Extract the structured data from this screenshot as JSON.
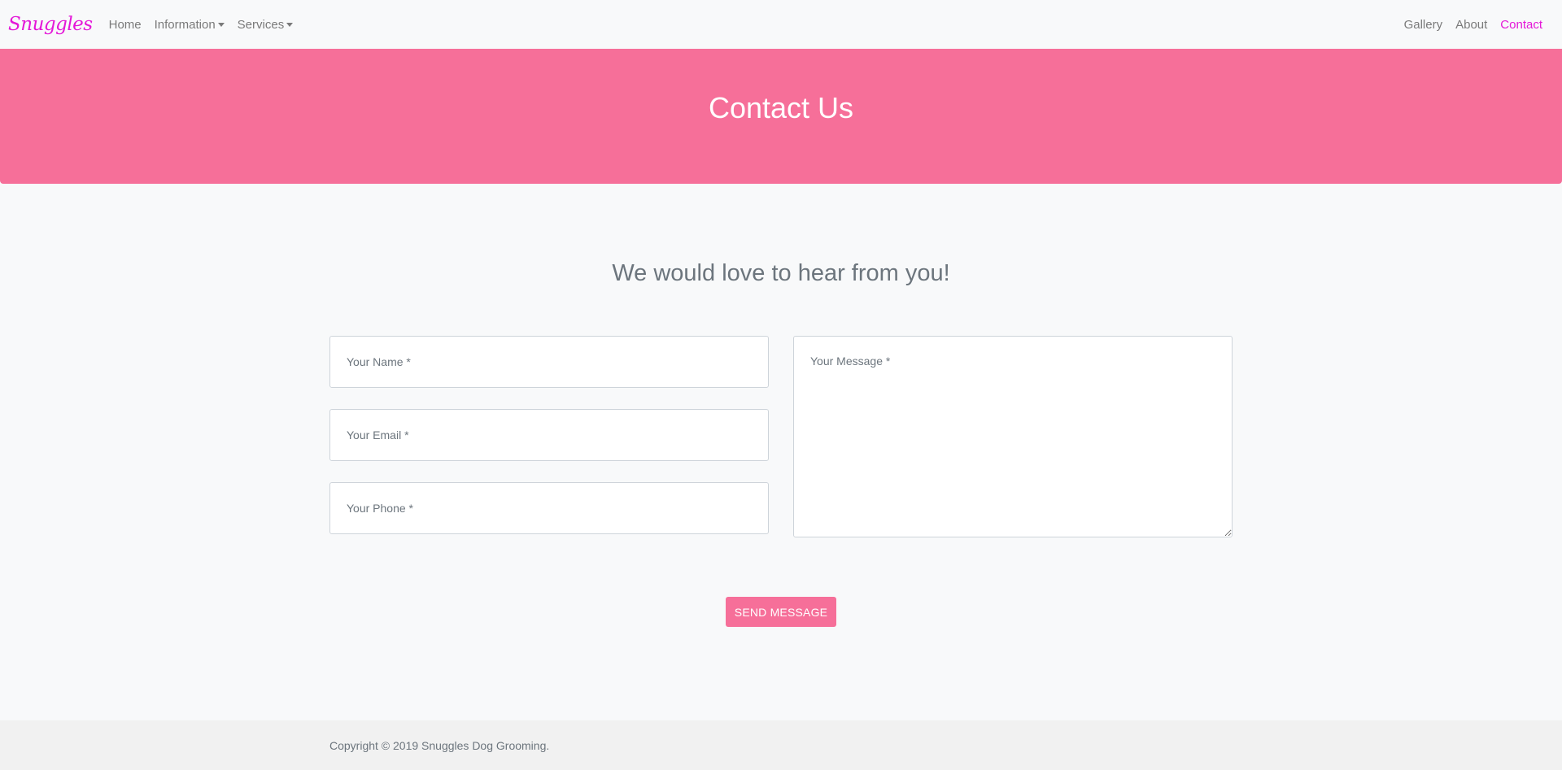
{
  "nav": {
    "brand": "Snuggles",
    "left_items": [
      {
        "label": "Home"
      },
      {
        "label": "Information"
      },
      {
        "label": "Services"
      }
    ],
    "right_items": [
      {
        "label": "Gallery"
      },
      {
        "label": "About"
      },
      {
        "label": "Contact"
      }
    ]
  },
  "hero": {
    "title": "Contact Us"
  },
  "main": {
    "heading": "We would love to hear from you!",
    "form": {
      "name_placeholder": "Your Name *",
      "email_placeholder": "Your Email *",
      "phone_placeholder": "Your Phone *",
      "message_placeholder": "Your Message *",
      "submit_label": "SEND MESSAGE"
    }
  },
  "footer": {
    "copyright": "Copyright © 2019 Snuggles Dog Grooming."
  },
  "colors": {
    "brand": "#e418d8",
    "accent": "#f66f99",
    "background": "#f8f9fa",
    "footer_bg": "#f1f1f1"
  },
  "icons": {
    "dropdown": "caret-down-icon"
  }
}
